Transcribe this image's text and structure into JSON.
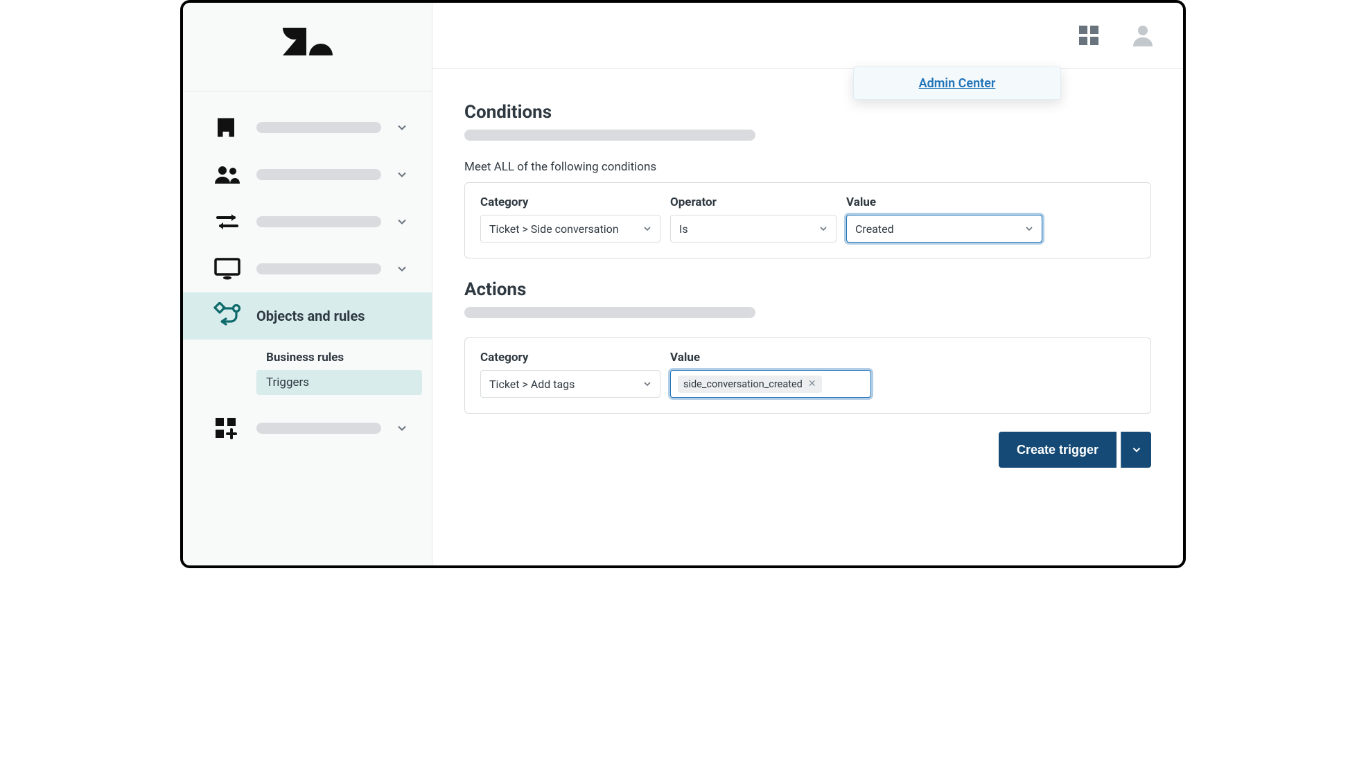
{
  "header": {
    "admin_center_label": "Admin Center"
  },
  "sidebar": {
    "objects_and_rules_label": "Objects and rules",
    "business_rules_label": "Business rules",
    "triggers_label": "Triggers"
  },
  "conditions": {
    "title": "Conditions",
    "meet_all_hint": "Meet ALL of the following conditions",
    "labels": {
      "category": "Category",
      "operator": "Operator",
      "value": "Value"
    },
    "row": {
      "category": "Ticket > Side conversation",
      "operator": "Is",
      "value": "Created"
    }
  },
  "actions": {
    "title": "Actions",
    "labels": {
      "category": "Category",
      "value": "Value"
    },
    "row": {
      "category": "Ticket > Add tags",
      "tag": "side_conversation_created"
    }
  },
  "footer": {
    "create_trigger_label": "Create trigger"
  }
}
